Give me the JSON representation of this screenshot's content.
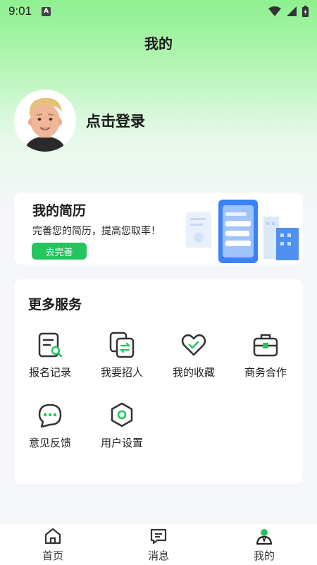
{
  "status": {
    "time": "9:01",
    "notification_badge": "A"
  },
  "header": {
    "title": "我的"
  },
  "profile": {
    "login_text": "点击登录",
    "avatar_icon": "avatar-3d-man"
  },
  "resume": {
    "title": "我的简历",
    "description": "完善您的简历，提高您取率！",
    "button": "去完善"
  },
  "services": {
    "title": "更多服务",
    "items": [
      {
        "label": "报名记录",
        "icon": "record-search-icon"
      },
      {
        "label": "我要招人",
        "icon": "recruit-swap-icon"
      },
      {
        "label": "我的收藏",
        "icon": "heart-icon"
      },
      {
        "label": "商务合作",
        "icon": "briefcase-icon"
      },
      {
        "label": "意见反馈",
        "icon": "chat-bubble-icon"
      },
      {
        "label": "用户设置",
        "icon": "settings-hex-icon"
      }
    ]
  },
  "tabbar": {
    "items": [
      {
        "label": "首页",
        "icon": "home-icon",
        "active": false
      },
      {
        "label": "消息",
        "icon": "message-icon",
        "active": false
      },
      {
        "label": "我的",
        "icon": "user-icon",
        "active": true
      }
    ]
  },
  "colors": {
    "accent": "#22c55e",
    "header_gradient_top": "#8ef08e"
  }
}
